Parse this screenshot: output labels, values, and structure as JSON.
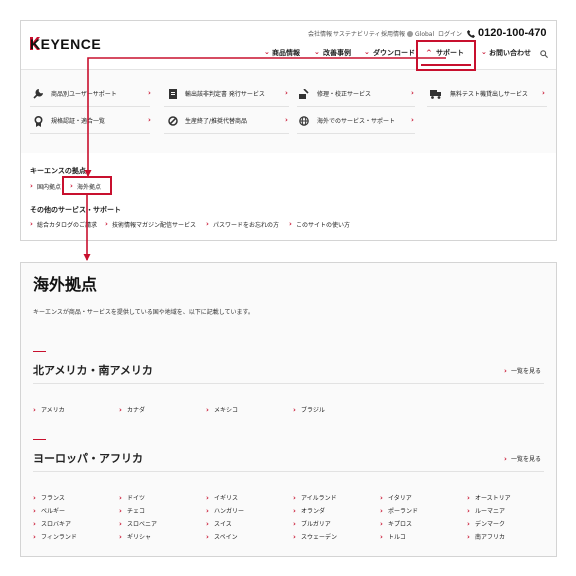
{
  "header": {
    "logo": "KEYENCE",
    "utility_links": [
      "会社情報",
      "サステナビリティ",
      "採用情報"
    ],
    "global_label": "Global",
    "login_label": "ログイン",
    "phone": "0120-100-470",
    "nav": [
      "商品情報",
      "改善事例",
      "ダウンロード",
      "サポート",
      "お問い合わせ"
    ]
  },
  "support_menu": {
    "items": [
      {
        "label": "商品別ユーザーサポート",
        "icon": "wrench-icon"
      },
      {
        "label": "輸出該非判定書 発行サービス",
        "icon": "document-icon"
      },
      {
        "label": "修理・校正サービス",
        "icon": "repair-icon"
      },
      {
        "label": "無料テスト機貸出しサービス",
        "icon": "truck-icon"
      },
      {
        "label": "規格認証・適合一覧",
        "icon": "certificate-icon"
      },
      {
        "label": "生産終了/推奨代替商品",
        "icon": "prohibited-icon"
      },
      {
        "label": "海外でのサービス・サポート",
        "icon": "globe-icon"
      }
    ],
    "bases_heading": "キーエンスの拠点",
    "bases_links": [
      "国内拠点",
      "海外拠点"
    ],
    "other_heading": "その他のサービス・サポート",
    "other_links": [
      "総合カタログのご請求",
      "技術情報マガジン配信サービス",
      "パスワードをお忘れの方",
      "このサイトの使い方"
    ]
  },
  "page": {
    "title": "海外拠点",
    "description": "キーエンスが商品・サービスを提供している国や地域を、以下に記載しています。",
    "view_all_label": "一覧を見る",
    "regions": [
      {
        "name": "北アメリカ・南アメリカ",
        "countries": [
          "アメリカ",
          "カナダ",
          "メキシコ",
          "ブラジル"
        ]
      },
      {
        "name": "ヨーロッパ・アフリカ",
        "countries": [
          "フランス",
          "ドイツ",
          "イギリス",
          "アイルランド",
          "イタリア",
          "オーストリア",
          "ベルギー",
          "チェコ",
          "ハンガリー",
          "オランダ",
          "ポーランド",
          "ルーマニア",
          "スロバキア",
          "スロベニア",
          "スイス",
          "ブルガリア",
          "キプロス",
          "デンマーク",
          "フィンランド",
          "ギリシャ",
          "スペイン",
          "スウェーデン",
          "トルコ",
          "南アフリカ"
        ]
      }
    ]
  },
  "colors": {
    "accent": "#c8102e",
    "border": "#d4d4d4",
    "panel_bg": "#fafafa",
    "text": "#222222"
  }
}
